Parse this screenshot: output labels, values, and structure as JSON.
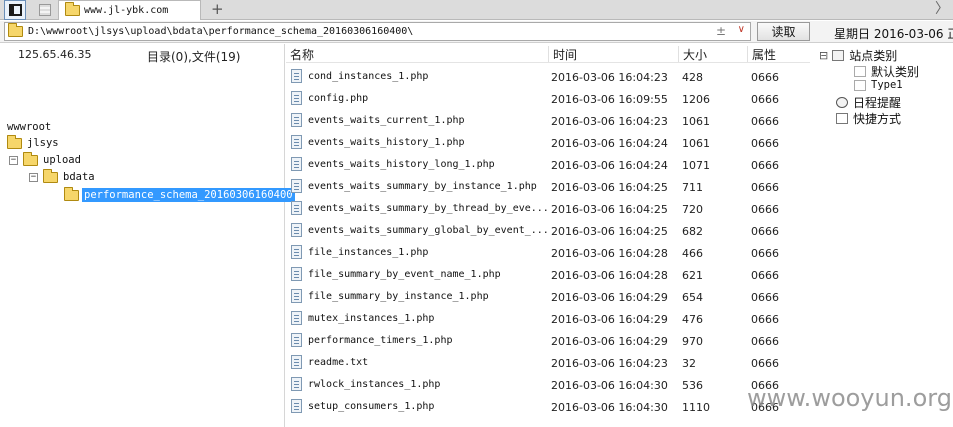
{
  "tabbar": {
    "tab_title": "www.jl-ybk.com",
    "add_tab": "+",
    "scroll_right": "〉"
  },
  "addressbar": {
    "path": "D:\\wwwroot\\jlsys\\upload\\bdata\\performance_schema_20160306160400\\",
    "pm_glyph": "±",
    "dropdown_glyph": "∨",
    "read_button": "读取",
    "date": "星期日 2016-03-06 正"
  },
  "leftpane": {
    "ip": "125.65.46.35",
    "summary": "目录(0),文件(19)",
    "tree": {
      "root": "wwwroot",
      "n1": "jlsys",
      "n2": "upload",
      "n3": "bdata",
      "n4": "performance_schema_20160306160400",
      "collapse_glyph": "−"
    }
  },
  "filelist": {
    "headers": {
      "name": "名称",
      "time": "时间",
      "size": "大小",
      "attr": "属性"
    },
    "rows": [
      {
        "name": "cond_instances_1.php",
        "time": "2016-03-06 16:04:23",
        "size": "428",
        "attr": "0666"
      },
      {
        "name": "config.php",
        "time": "2016-03-06 16:09:55",
        "size": "1206",
        "attr": "0666"
      },
      {
        "name": "events_waits_current_1.php",
        "time": "2016-03-06 16:04:23",
        "size": "1061",
        "attr": "0666"
      },
      {
        "name": "events_waits_history_1.php",
        "time": "2016-03-06 16:04:24",
        "size": "1061",
        "attr": "0666"
      },
      {
        "name": "events_waits_history_long_1.php",
        "time": "2016-03-06 16:04:24",
        "size": "1071",
        "attr": "0666"
      },
      {
        "name": "events_waits_summary_by_instance_1.php",
        "time": "2016-03-06 16:04:25",
        "size": "711",
        "attr": "0666"
      },
      {
        "name": "events_waits_summary_by_thread_by_eve...",
        "time": "2016-03-06 16:04:25",
        "size": "720",
        "attr": "0666"
      },
      {
        "name": "events_waits_summary_global_by_event_...",
        "time": "2016-03-06 16:04:25",
        "size": "682",
        "attr": "0666"
      },
      {
        "name": "file_instances_1.php",
        "time": "2016-03-06 16:04:28",
        "size": "466",
        "attr": "0666"
      },
      {
        "name": "file_summary_by_event_name_1.php",
        "time": "2016-03-06 16:04:28",
        "size": "621",
        "attr": "0666"
      },
      {
        "name": "file_summary_by_instance_1.php",
        "time": "2016-03-06 16:04:29",
        "size": "654",
        "attr": "0666"
      },
      {
        "name": "mutex_instances_1.php",
        "time": "2016-03-06 16:04:29",
        "size": "476",
        "attr": "0666"
      },
      {
        "name": "performance_timers_1.php",
        "time": "2016-03-06 16:04:29",
        "size": "970",
        "attr": "0666"
      },
      {
        "name": "readme.txt",
        "time": "2016-03-06 16:04:23",
        "size": "32",
        "attr": "0666"
      },
      {
        "name": "rwlock_instances_1.php",
        "time": "2016-03-06 16:04:30",
        "size": "536",
        "attr": "0666"
      },
      {
        "name": "setup_consumers_1.php",
        "time": "2016-03-06 16:04:30",
        "size": "1110",
        "attr": "0666"
      }
    ]
  },
  "rightpane": {
    "site_category": "站点类别",
    "default_category": "默认类别",
    "type1": "Type1",
    "schedule": "日程提醒",
    "shortcut": "快捷方式",
    "expand_glyph": "⊟"
  },
  "watermark": "www.wooyun.org"
}
